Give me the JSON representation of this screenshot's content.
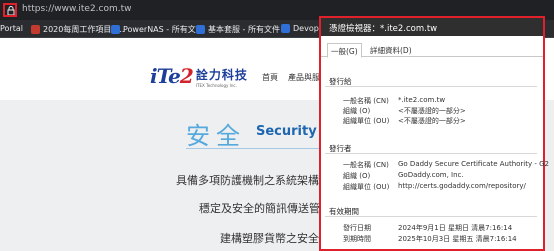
{
  "browser": {
    "url": "https://www.ite2.com.tw",
    "bookmarks": [
      {
        "label": "Portal",
        "color": ""
      },
      {
        "label": "2020每周工作項目 -...",
        "color": "#c23b2e"
      },
      {
        "label": "PowerNAS - 所有文件",
        "color": "#2f6fd6"
      },
      {
        "label": "基本套服 - 所有文件",
        "color": "#2f6fd6"
      },
      {
        "label": "Devops-",
        "color": "#2f6fd6"
      }
    ]
  },
  "site": {
    "logo_mark_1": "iTe",
    "logo_mark_2": "2",
    "logo_cn": "詮力科技",
    "logo_en": "ITEX Technology Inc.",
    "nav": [
      "首頁",
      "產品與服"
    ],
    "hero_cn": "安全",
    "hero_en": "Security",
    "lines": [
      "具備多項防護機制之系統架構",
      "穩定及安全的簡訊傳送管",
      "建構塑膠貨幣之安全"
    ]
  },
  "dialog": {
    "title": "憑證檢視器：*.ite2.com.tw",
    "tabs": [
      "一般(G)",
      "詳細資料(D)"
    ],
    "issued_to": {
      "heading": "發行給",
      "rows": [
        {
          "label": "一般名稱 (CN)",
          "value": "*.ite2.com.tw"
        },
        {
          "label": "組織 (O)",
          "value": "<不屬憑證的一部分>"
        },
        {
          "label": "組織單位 (OU)",
          "value": "<不屬憑證的一部分>"
        }
      ]
    },
    "issued_by": {
      "heading": "發行者",
      "rows": [
        {
          "label": "一般名稱 (CN)",
          "value": "Go Daddy Secure Certificate Authority - G2"
        },
        {
          "label": "組織 (O)",
          "value": "GoDaddy.com, Inc."
        },
        {
          "label": "組織單位 (OU)",
          "value": "http://certs.godaddy.com/repository/"
        }
      ]
    },
    "validity": {
      "heading": "有效期間",
      "rows": [
        {
          "label": "發行日期",
          "value": "2024年9月1日 星期日 清晨7:16:14"
        },
        {
          "label": "到期時間",
          "value": "2025年10月3日 星期五 清晨7:16:14"
        }
      ]
    }
  },
  "colors": {
    "highlight": "#e0202a",
    "brand_blue": "#1c3f9a",
    "hero_blue": "#56a9dd"
  }
}
